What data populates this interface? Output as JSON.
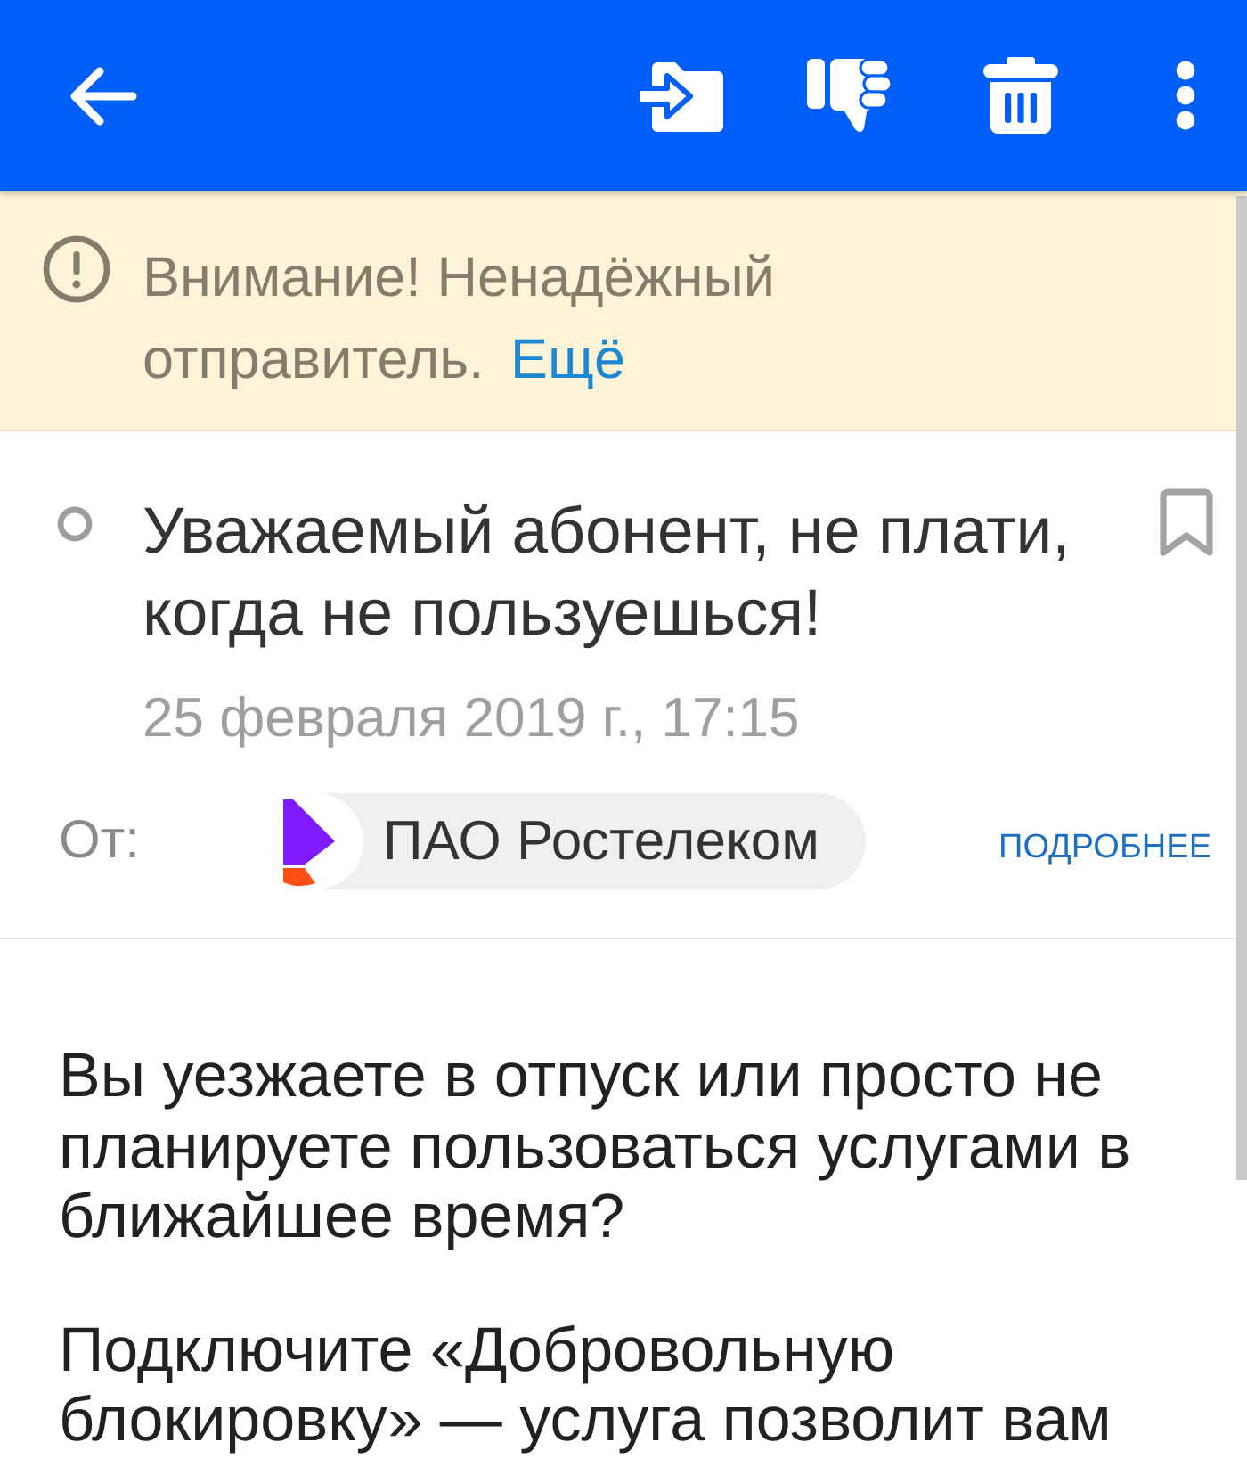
{
  "warning_banner": {
    "text": "Внимание! Ненадёжный отправитель.",
    "link": "Ещё"
  },
  "message": {
    "unread": false,
    "subject": "Уважаемый абонент, не плати, когда не пользуешься!",
    "flagged": false,
    "date": "25 февраля 2019 г., 17:15",
    "from_label": "От:",
    "sender": "ПАО Ростелеком",
    "details_link": "ПОДРОБНЕЕ"
  },
  "body": {
    "paragraphs": [
      "Вы уезжаете в отпуск или просто не планируете пользоваться услугами в ближайшее время?",
      "Подключите «Добровольную блокировку» — услуга позволит вам"
    ]
  }
}
